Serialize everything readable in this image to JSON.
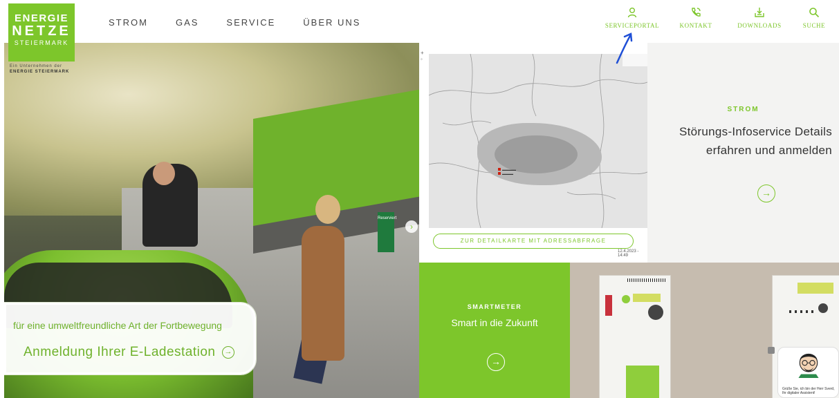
{
  "logo": {
    "line1": "ENERGIE",
    "line2": "NETZE",
    "line3": "STEIERMARK",
    "tag_prefix": "Ein Unternehmen der",
    "tag_company": "ENERGIE STEIERMARK",
    "color": "#7dc62b"
  },
  "nav": [
    "STROM",
    "GAS",
    "SERVICE",
    "ÜBER UNS"
  ],
  "tools": [
    {
      "label": "SERVICEPORTAL",
      "icon": "user-icon"
    },
    {
      "label": "KONTAKT",
      "icon": "phone-icon"
    },
    {
      "label": "DOWNLOADS",
      "icon": "download-icon"
    },
    {
      "label": "SUCHE",
      "icon": "search-icon"
    }
  ],
  "hero": {
    "subtitle": "für eine umweltfreundliche Art der Fortbewegung",
    "title": "Anmeldung Ihrer E-Ladestation",
    "sign_text": "Reserviert"
  },
  "map": {
    "button": "ZUR DETAILKARTE MIT ADRESSABFRAGE",
    "timestamp": "12.4.2023 - 14:49"
  },
  "strom": {
    "kicker": "STROM",
    "title": "Störungs-Infoservice Details erfahren und anmelden"
  },
  "smartmeter": {
    "kicker": "SMARTMETER",
    "title": "Smart in die Zukunft"
  },
  "assistant": {
    "text": "Grüße Sie, ich bin der Herr Sverd, Ihr digitaler Assistent!"
  },
  "colors": {
    "brand_green": "#7dc62b",
    "annotation_blue": "#1f4fd6"
  }
}
